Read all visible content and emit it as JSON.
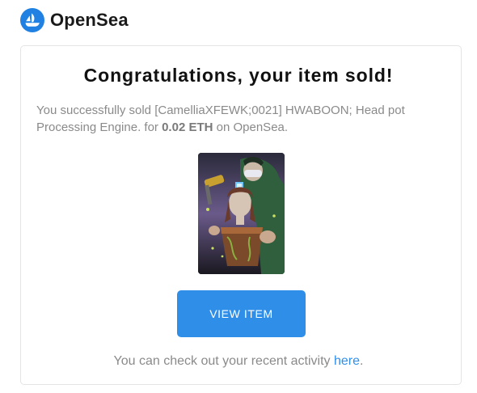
{
  "header": {
    "brand": "OpenSea",
    "logo_icon": "opensea-sailboat-icon"
  },
  "card": {
    "title": "Congratulations, your item sold!",
    "message_prefix": "You successfully sold [CamelliaXFEWK;0021] HWABOON; Head pot Processing Engine. for ",
    "price": "0.02 ETH",
    "message_suffix": " on OpenSea.",
    "nft_image": "nft-artwork-hwaboon-head-pot",
    "button_label": "VIEW ITEM",
    "footer_prefix": "You can check out your recent activity ",
    "footer_link": "here",
    "footer_suffix": "."
  },
  "colors": {
    "accent": "#2f8ee8",
    "logo_blue": "#2081e2",
    "text_muted": "#8a8a8a"
  }
}
